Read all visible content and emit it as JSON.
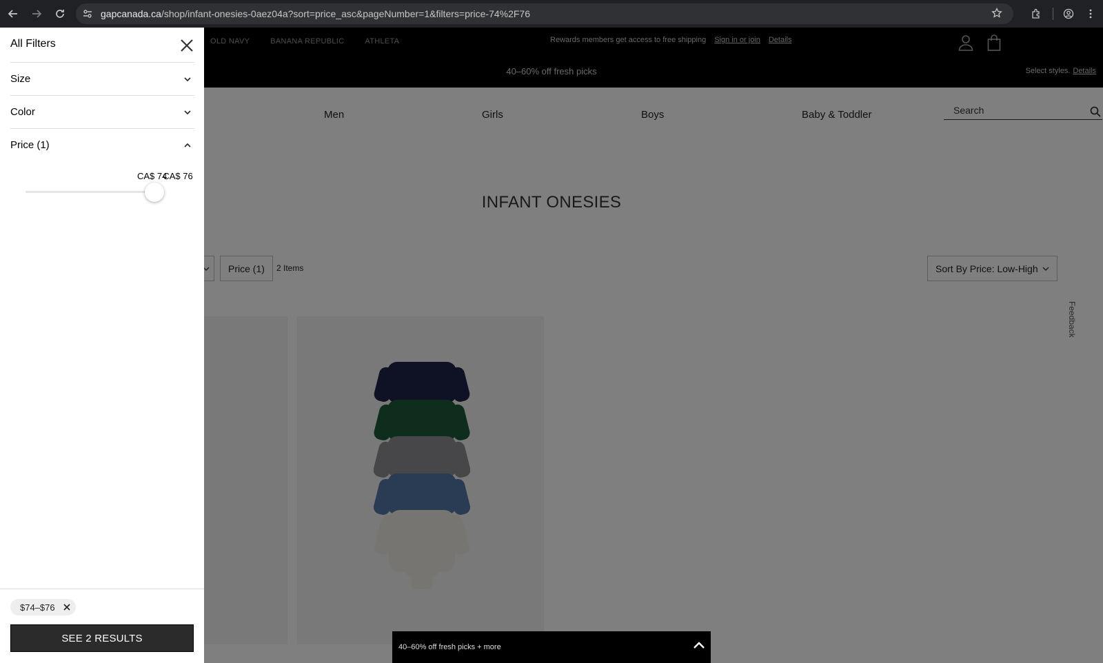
{
  "browser": {
    "url_host": "gapcanada.ca",
    "url_path": "/shop/infant-onesies-0aez04a?sort=price_asc&pageNumber=1&filters=price-74%2F76"
  },
  "header": {
    "brands": [
      "OLD NAVY",
      "BANANA REPUBLIC",
      "ATHLETA"
    ],
    "rewards_text": "Rewards members get access to free shipping",
    "sign_in": "Sign in or join",
    "details": "Details",
    "promo": "40–60% off fresh picks",
    "promo_right": "Select styles.",
    "promo_right_link": "Details"
  },
  "nav": {
    "items": [
      "Men",
      "Girls",
      "Boys",
      "Baby & Toddler"
    ],
    "search_placeholder": "Search"
  },
  "main": {
    "title": "INFANT ONESIES",
    "price_chip": "Price (1)",
    "items_count": "2 Items",
    "sort_label": "Sort By Price: Low-High",
    "feedback": "Feedback",
    "bottom_promo": "40–60% off fresh picks + more"
  },
  "filters": {
    "title": "All Filters",
    "facets": [
      "Size",
      "Color",
      "Price (1)"
    ],
    "price_min_label": "CA$ 74",
    "price_max_label": "CA$ 76",
    "selected_pill": "$74–$76",
    "see_results": "SEE 2 RESULTS"
  }
}
